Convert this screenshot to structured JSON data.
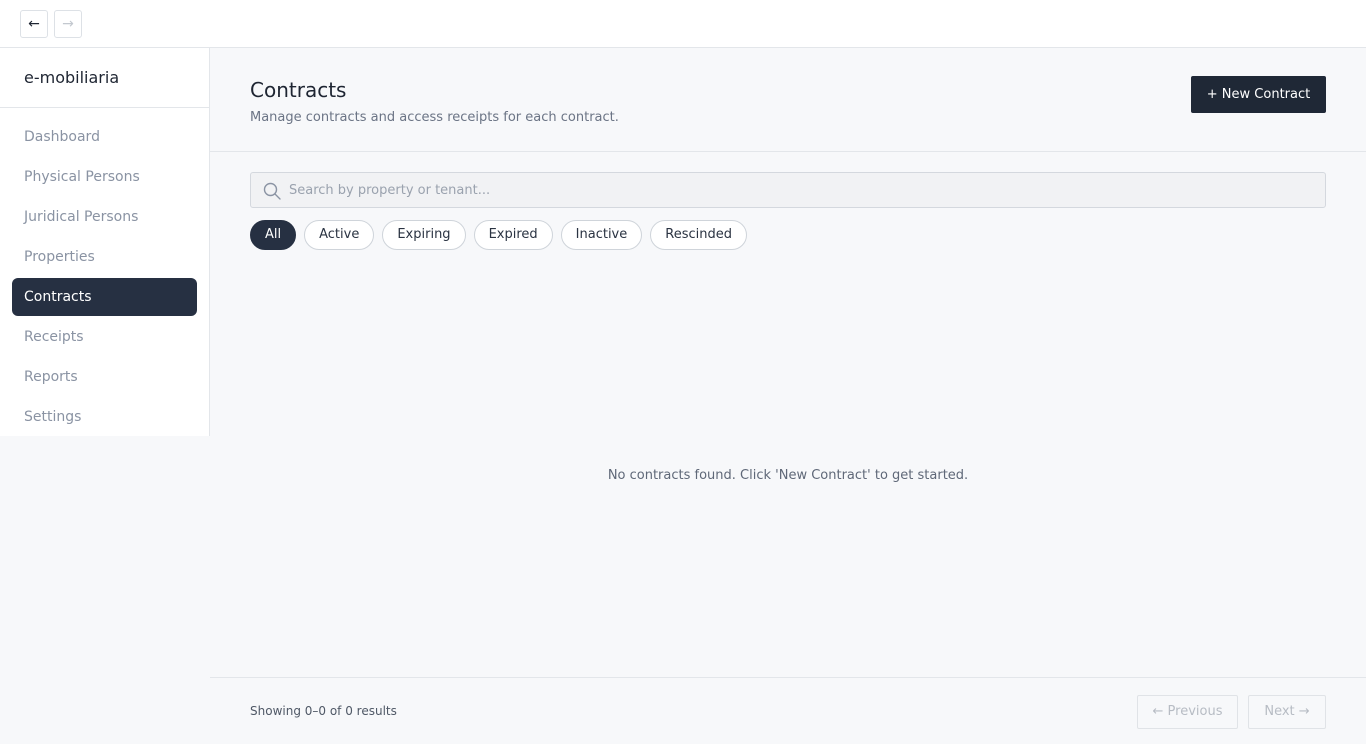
{
  "topbar": {
    "back_label": "←",
    "forward_label": "→"
  },
  "sidebar": {
    "brand": "e-mobiliaria",
    "items": [
      {
        "label": "Dashboard",
        "active": false
      },
      {
        "label": "Physical Persons",
        "active": false
      },
      {
        "label": "Juridical Persons",
        "active": false
      },
      {
        "label": "Properties",
        "active": false
      },
      {
        "label": "Contracts",
        "active": true
      },
      {
        "label": "Receipts",
        "active": false
      },
      {
        "label": "Reports",
        "active": false
      },
      {
        "label": "Settings",
        "active": false
      }
    ]
  },
  "header": {
    "title": "Contracts",
    "subtitle": "Manage contracts and access receipts for each contract.",
    "new_button": "+ New Contract"
  },
  "search": {
    "placeholder": "Search by property or tenant...",
    "value": "",
    "icon": "search-icon"
  },
  "filters": [
    {
      "label": "All",
      "active": true
    },
    {
      "label": "Active",
      "active": false
    },
    {
      "label": "Expiring",
      "active": false
    },
    {
      "label": "Expired",
      "active": false
    },
    {
      "label": "Inactive",
      "active": false
    },
    {
      "label": "Rescinded",
      "active": false
    }
  ],
  "empty_message": "No contracts found. Click 'New Contract' to get started.",
  "footer": {
    "results_text": "Showing 0–0 of 0 results",
    "previous_label": "← Previous",
    "next_label": "Next →"
  },
  "colors": {
    "accent": "#263042",
    "background": "#f7f8fa"
  }
}
